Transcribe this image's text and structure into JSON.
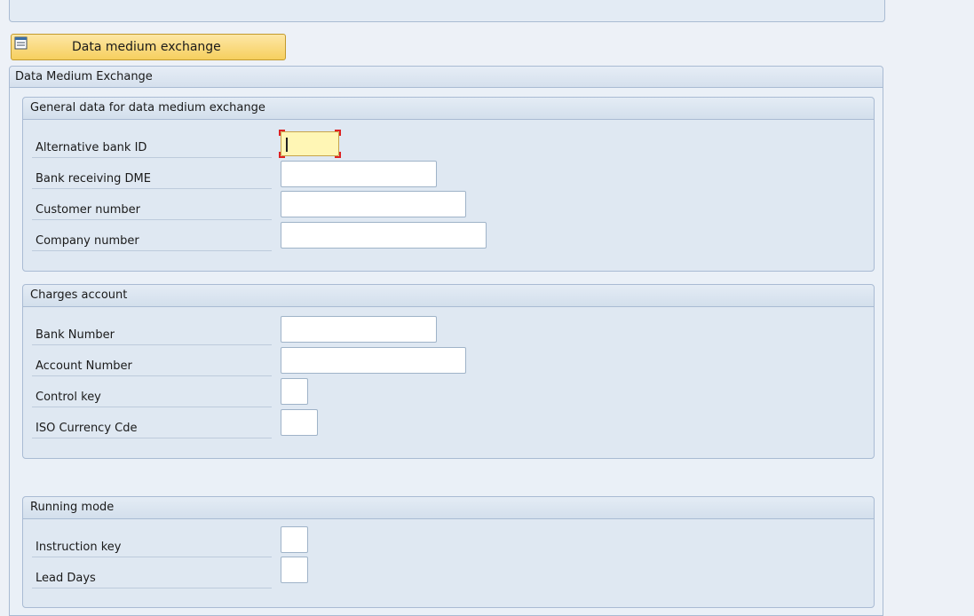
{
  "top_panel": {},
  "button": {
    "label": "Data medium exchange",
    "icon": "document-list-icon"
  },
  "main": {
    "title": "Data Medium Exchange"
  },
  "groups": {
    "general": {
      "title": "General data for data medium exchange",
      "fields": [
        {
          "label": "Alternative bank ID",
          "value": ""
        },
        {
          "label": "Bank receiving DME",
          "value": ""
        },
        {
          "label": "Customer number",
          "value": ""
        },
        {
          "label": "Company number",
          "value": ""
        }
      ]
    },
    "charges": {
      "title": "Charges account",
      "fields": [
        {
          "label": "Bank Number",
          "value": ""
        },
        {
          "label": "Account Number",
          "value": ""
        },
        {
          "label": "Control key",
          "value": ""
        },
        {
          "label": "ISO Currency Cde",
          "value": ""
        }
      ]
    },
    "running": {
      "title": "Running mode",
      "fields": [
        {
          "label": "Instruction key",
          "value": ""
        },
        {
          "label": "Lead Days",
          "value": ""
        }
      ]
    }
  }
}
